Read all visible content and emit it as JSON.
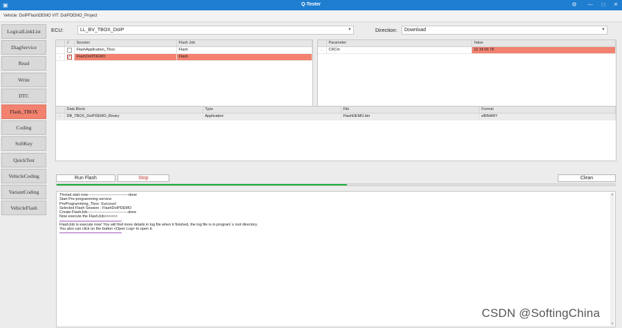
{
  "window": {
    "title": "Q-Tester",
    "controls": [
      "⚙",
      "—",
      "□",
      "✕"
    ]
  },
  "infobar": {
    "text": "Vehicle: DoIPFlashDEMO VIT: DoIPDEMO_Project"
  },
  "sidebar": {
    "items": [
      {
        "label": "LogicalLinkList",
        "active": false
      },
      {
        "label": "DiagService",
        "active": false
      },
      {
        "label": "Read",
        "active": false
      },
      {
        "label": "Write",
        "active": false
      },
      {
        "label": "DTC",
        "active": false
      },
      {
        "label": "Flash_TBOX",
        "active": true
      },
      {
        "label": "Coding",
        "active": false
      },
      {
        "label": "SoftKey",
        "active": false
      },
      {
        "label": "QuickTest",
        "active": false
      },
      {
        "label": "VehicleCoding",
        "active": false
      },
      {
        "label": "VariantCoding",
        "active": false
      },
      {
        "label": "VehicleFlash",
        "active": false
      }
    ]
  },
  "ecu": {
    "label": "ECU:",
    "value": "LL_BV_TBOX_DoIP",
    "direction_label": "Direction:",
    "direction_value": "Download"
  },
  "session_table": {
    "headers": [
      "",
      "√",
      "Session",
      "Flash Job"
    ],
    "rows": [
      {
        "mark": "",
        "checked": false,
        "session": "FlashApplication_Tbox",
        "job": "Flash",
        "selected": false
      },
      {
        "mark": "→",
        "checked": true,
        "session": "FlashDoIPDEMO",
        "job": "Flash",
        "selected": true
      }
    ]
  },
  "param_table": {
    "headers": [
      "",
      "Parameter",
      "Value"
    ],
    "rows": [
      {
        "mark": "→",
        "parameter": "CRCIn",
        "value": "12 34 56 78",
        "selected": true
      }
    ]
  },
  "block_table": {
    "headers": [
      "",
      "Data Block",
      "Type",
      "File",
      "Format"
    ],
    "rows": [
      {
        "mark": "→",
        "block": "DB_TBOX_DoIPDEMO_Binary",
        "type": "Application",
        "file": "FlashDEMO.bin",
        "format": "eBINARY"
      }
    ]
  },
  "actions": {
    "run": "Run Flash",
    "stop": "Stop",
    "clean": "Clean",
    "progress": 0.52
  },
  "log": {
    "lines": [
      "Thread start now--------------------------------done",
      "Start Pre-programming service:",
      "PreProgramming_Tbox: Success!",
      "Selected Flash Session : FlashDoIPDEMO",
      "Create FlashJob--------------------------------done",
      "Now execute the FlashJob>>>>>>"
    ],
    "lines2": [
      "FlashJob is execute now! You will find more details in log file when it finished, the log file is in program`s root directory.",
      "You also can click on the button <Open Log> to open it."
    ]
  },
  "watermark": "CSDN @SoftingChina",
  "colors": {
    "titlebar": "#1f7ed0",
    "active_nav": "#f2826f",
    "selected_row": "#f2826f",
    "progress": "#1bae3a"
  }
}
